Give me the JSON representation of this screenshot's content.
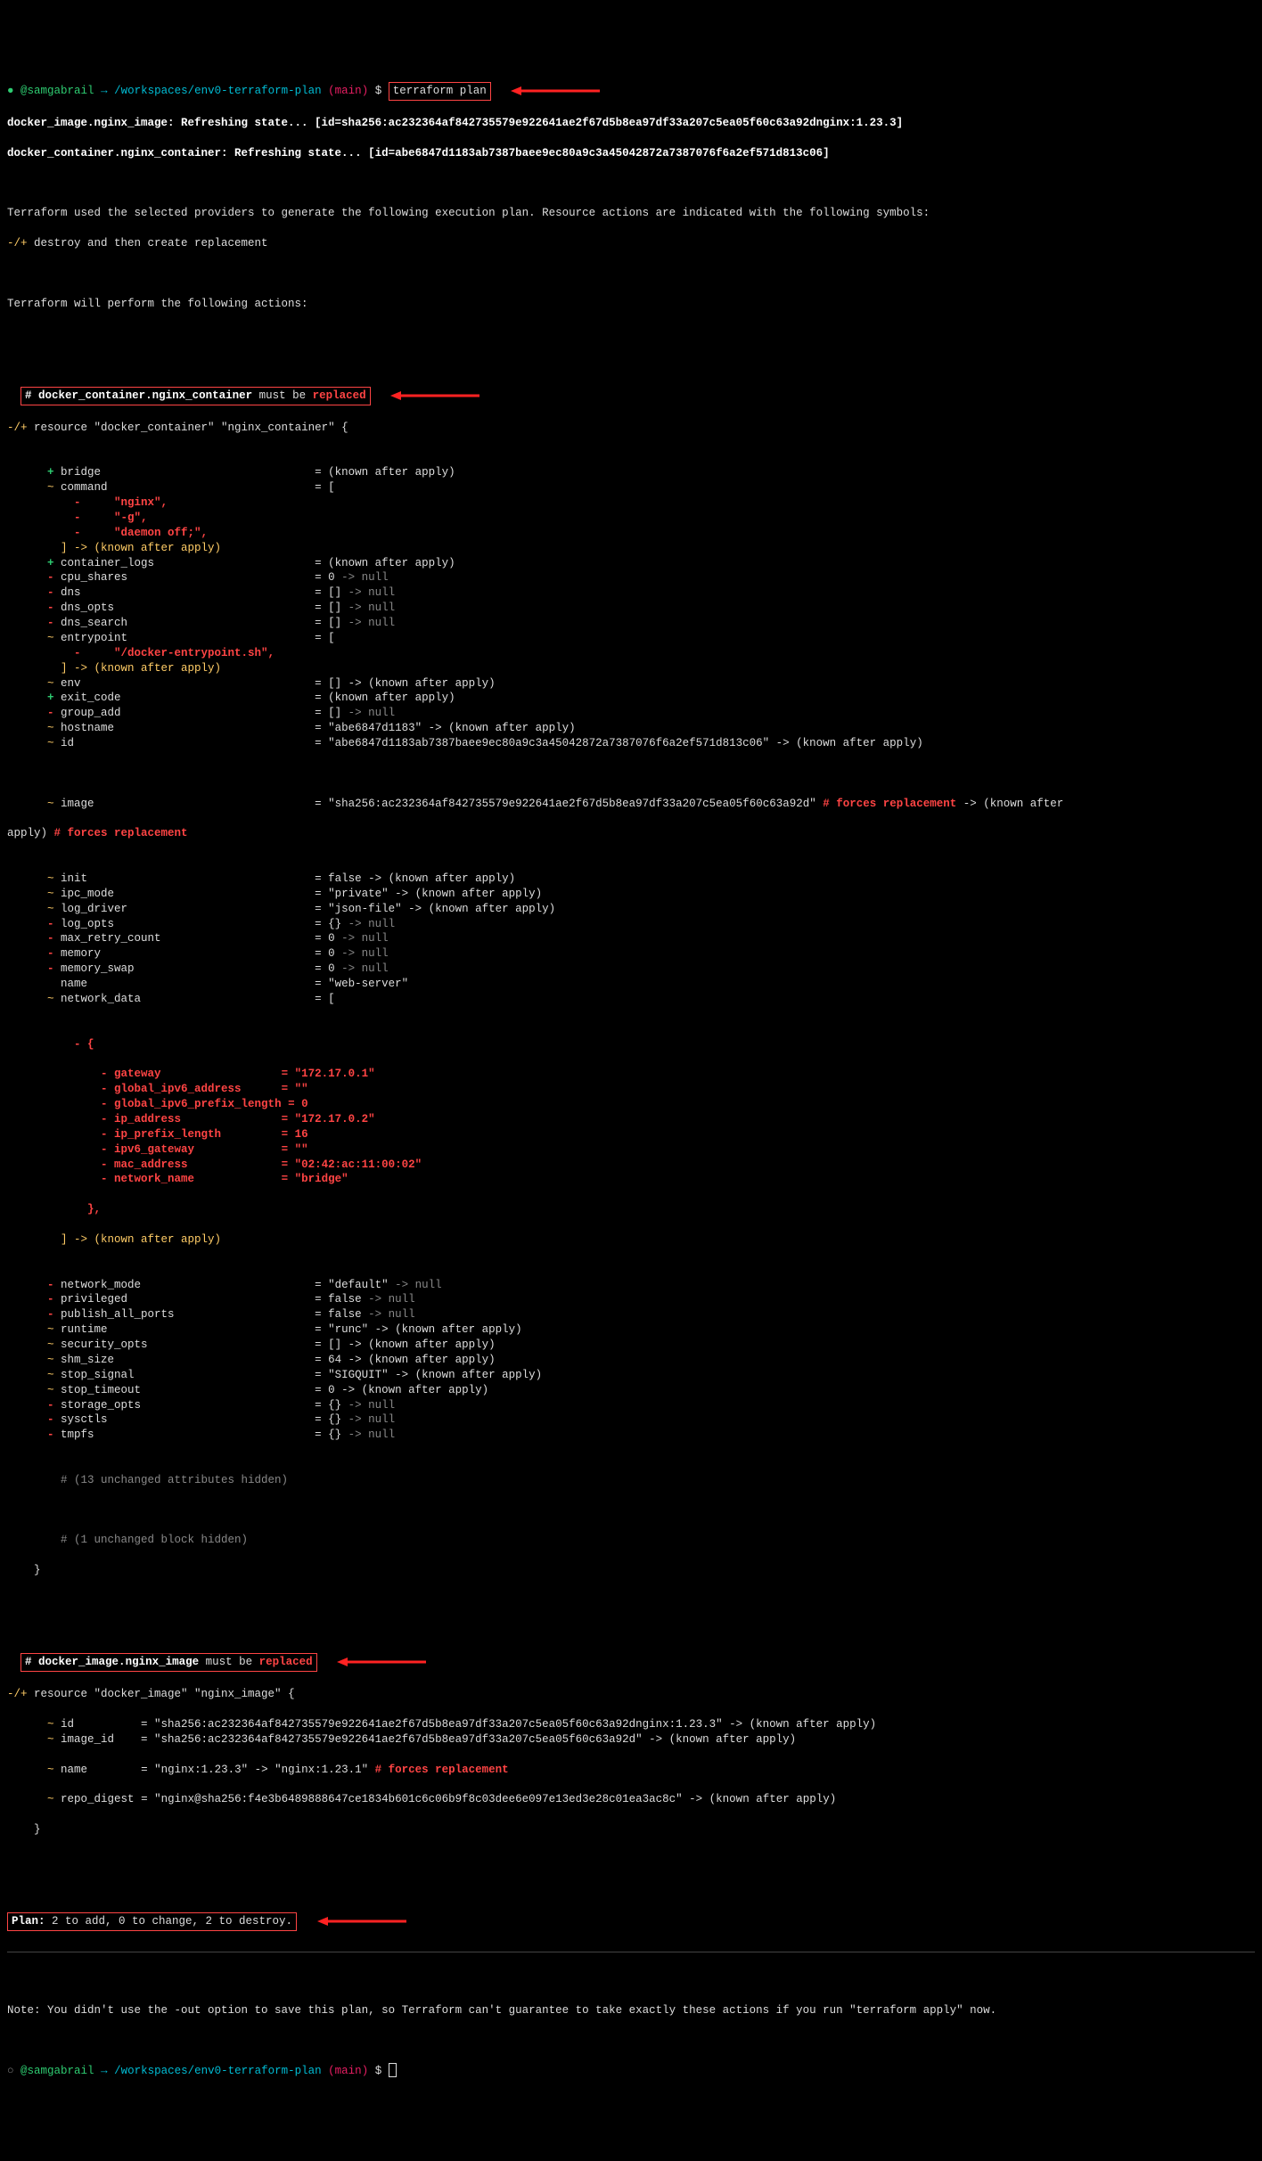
{
  "prompt": {
    "dot": "●",
    "user": "@samgabrail",
    "arrow": "→",
    "path": "/workspaces/env0-terraform-plan",
    "branch_open": "(",
    "branch": "main",
    "branch_close": ")",
    "dollar": "$",
    "command": "terraform plan"
  },
  "refresh": {
    "line1": "docker_image.nginx_image: Refreshing state... [id=sha256:ac232364af842735579e922641ae2f67d5b8ea97df33a207c5ea05f60c63a92dnginx:1.23.3]",
    "line2": "docker_container.nginx_container: Refreshing state... [id=abe6847d1183ab7387baee9ec80a9c3a45042872a7387076f6a2ef571d813c06]"
  },
  "intro": {
    "l1": "Terraform used the selected providers to generate the following execution plan. Resource actions are indicated with the following symbols:",
    "sym_prefix": "-/+",
    "sym_text": " destroy and then create replacement",
    "l2": "Terraform will perform the following actions:"
  },
  "container_header": {
    "hash": "#",
    "name": "docker_container.nginx_container",
    "mid": " must be ",
    "replaced": "replaced"
  },
  "container_res_open_prefix": "-/+",
  "container_res_open": " resource \"docker_container\" \"nginx_container\" {",
  "attrs": [
    {
      "sym": "+",
      "name": "bridge",
      "eq": "= (known after apply)",
      "pad": 7
    },
    {
      "sym": "~",
      "name": "command",
      "eq": "= [",
      "pad": 7
    },
    {
      "sym": "-",
      "name": "    \"nginx\",",
      "eq": "",
      "pad": 11,
      "raw": true
    },
    {
      "sym": "-",
      "name": "    \"-g\",",
      "eq": "",
      "pad": 11,
      "raw": true
    },
    {
      "sym": "-",
      "name": "    \"daemon off;\",",
      "eq": "",
      "pad": 11,
      "raw": true
    },
    {
      "sym": " ",
      "name": "] -> (known after apply)",
      "eq": "",
      "pad": 7,
      "raw": true,
      "noSym": true,
      "yellow": true
    },
    {
      "sym": "+",
      "name": "container_logs",
      "eq": "= (known after apply)",
      "pad": 7
    },
    {
      "sym": "-",
      "name": "cpu_shares",
      "eq": "= 0 -> null",
      "pad": 7,
      "null": true
    },
    {
      "sym": "-",
      "name": "dns",
      "eq": "= [] -> null",
      "pad": 7,
      "null": true
    },
    {
      "sym": "-",
      "name": "dns_opts",
      "eq": "= [] -> null",
      "pad": 7,
      "null": true
    },
    {
      "sym": "-",
      "name": "dns_search",
      "eq": "= [] -> null",
      "pad": 7,
      "null": true
    },
    {
      "sym": "~",
      "name": "entrypoint",
      "eq": "= [",
      "pad": 7
    },
    {
      "sym": "-",
      "name": "    \"/docker-entrypoint.sh\",",
      "eq": "",
      "pad": 11,
      "raw": true
    },
    {
      "sym": " ",
      "name": "] -> (known after apply)",
      "eq": "",
      "pad": 7,
      "raw": true,
      "noSym": true,
      "yellow": true
    },
    {
      "sym": "~",
      "name": "env",
      "eq": "= [] -> (known after apply)",
      "pad": 7
    },
    {
      "sym": "+",
      "name": "exit_code",
      "eq": "= (known after apply)",
      "pad": 7
    },
    {
      "sym": "-",
      "name": "group_add",
      "eq": "= [] -> null",
      "pad": 7,
      "null": true
    },
    {
      "sym": "~",
      "name": "hostname",
      "eq": "= \"abe6847d1183\" -> (known after apply)",
      "pad": 7
    },
    {
      "sym": "~",
      "name": "id",
      "eq": "= \"abe6847d1183ab7387baee9ec80a9c3a45042872a7387076f6a2ef571d813c06\" -> (known after apply)",
      "pad": 7
    }
  ],
  "image_line": {
    "sym": "~",
    "name": "image",
    "value": "= \"sha256:ac232364af842735579e922641ae2f67d5b8ea97df33a207c5ea05f60c63a92d\"",
    "forces": " # forces replacement",
    "arrow": " -> (known after ",
    "wrap_prefix": "apply)",
    "wrap_forces": " # forces replacement"
  },
  "attrs2": [
    {
      "sym": "~",
      "name": "init",
      "eq": "= false -> (known after apply)"
    },
    {
      "sym": "~",
      "name": "ipc_mode",
      "eq": "= \"private\" -> (known after apply)"
    },
    {
      "sym": "~",
      "name": "log_driver",
      "eq": "= \"json-file\" -> (known after apply)"
    },
    {
      "sym": "-",
      "name": "log_opts",
      "eq": "= {} -> null",
      "null": true
    },
    {
      "sym": "-",
      "name": "max_retry_count",
      "eq": "= 0 -> null",
      "null": true
    },
    {
      "sym": "-",
      "name": "memory",
      "eq": "= 0 -> null",
      "null": true
    },
    {
      "sym": "-",
      "name": "memory_swap",
      "eq": "= 0 -> null",
      "null": true
    },
    {
      "sym": " ",
      "name": "name",
      "eq": "= \"web-server\"",
      "plainSym": true
    },
    {
      "sym": "~",
      "name": "network_data",
      "eq": "= ["
    }
  ],
  "network_open": "          - {",
  "network": [
    {
      "name": "gateway",
      "val": "\"172.17.0.1\""
    },
    {
      "name": "global_ipv6_address",
      "val": "\"\""
    },
    {
      "name": "global_ipv6_prefix_length",
      "val": "0"
    },
    {
      "name": "ip_address",
      "val": "\"172.17.0.2\""
    },
    {
      "name": "ip_prefix_length",
      "val": "16"
    },
    {
      "name": "ipv6_gateway",
      "val": "\"\""
    },
    {
      "name": "mac_address",
      "val": "\"02:42:ac:11:00:02\""
    },
    {
      "name": "network_name",
      "val": "\"bridge\""
    }
  ],
  "network_close1": "            },",
  "network_close2": "        ] -> (known after apply)",
  "attrs3": [
    {
      "sym": "-",
      "name": "network_mode",
      "eq": "= \"default\" -> null",
      "null": true
    },
    {
      "sym": "-",
      "name": "privileged",
      "eq": "= false -> null",
      "null": true
    },
    {
      "sym": "-",
      "name": "publish_all_ports",
      "eq": "= false -> null",
      "null": true
    },
    {
      "sym": "~",
      "name": "runtime",
      "eq": "= \"runc\" -> (known after apply)"
    },
    {
      "sym": "~",
      "name": "security_opts",
      "eq": "= [] -> (known after apply)"
    },
    {
      "sym": "~",
      "name": "shm_size",
      "eq": "= 64 -> (known after apply)"
    },
    {
      "sym": "~",
      "name": "stop_signal",
      "eq": "= \"SIGQUIT\" -> (known after apply)"
    },
    {
      "sym": "~",
      "name": "stop_timeout",
      "eq": "= 0 -> (known after apply)"
    },
    {
      "sym": "-",
      "name": "storage_opts",
      "eq": "= {} -> null",
      "null": true
    },
    {
      "sym": "-",
      "name": "sysctls",
      "eq": "= {} -> null",
      "null": true
    },
    {
      "sym": "-",
      "name": "tmpfs",
      "eq": "= {} -> null",
      "null": true
    }
  ],
  "hidden1": "# (13 unchanged attributes hidden)",
  "hidden2": "# (1 unchanged block hidden)",
  "brace_close": "    }",
  "image_header": {
    "hash": "#",
    "name": "docker_image.nginx_image",
    "mid": " must be ",
    "replaced": "replaced"
  },
  "image_res_open_prefix": "-/+",
  "image_res_open": " resource \"docker_image\" \"nginx_image\" {",
  "image_attrs": [
    {
      "sym": "~",
      "name": "id",
      "val": "= \"sha256:ac232364af842735579e922641ae2f67d5b8ea97df33a207c5ea05f60c63a92dnginx:1.23.3\" -> (known after apply)"
    },
    {
      "sym": "~",
      "name": "image_id",
      "val": "= \"sha256:ac232364af842735579e922641ae2f67d5b8ea97df33a207c5ea05f60c63a92d\" -> (known after apply)"
    }
  ],
  "image_name_line": {
    "sym": "~",
    "name": "name",
    "pre": "= \"nginx:1.23.3\" -> \"nginx:1.23.1\"",
    "forces": " # forces replacement"
  },
  "image_repo": {
    "sym": "~",
    "name": "repo_digest",
    "val": "= \"nginx@sha256:f4e3b6489888647ce1834b601c6c06b9f8c03dee6e097e13ed3e28c01ea3ac8c\" -> (known after apply)"
  },
  "image_close": "    }",
  "plan": {
    "label": "Plan:",
    "text": " 2 to add, 0 to change, 2 to destroy."
  },
  "note": "Note: You didn't use the -out option to save this plan, so Terraform can't guarantee to take exactly these actions if you run \"terraform apply\" now.",
  "prompt2": {
    "dot": "○",
    "user": "@samgabrail",
    "arrow": "→",
    "path": "/workspaces/env0-terraform-plan",
    "branch_open": "(",
    "branch": "main",
    "branch_close": ")",
    "dollar": "$"
  }
}
